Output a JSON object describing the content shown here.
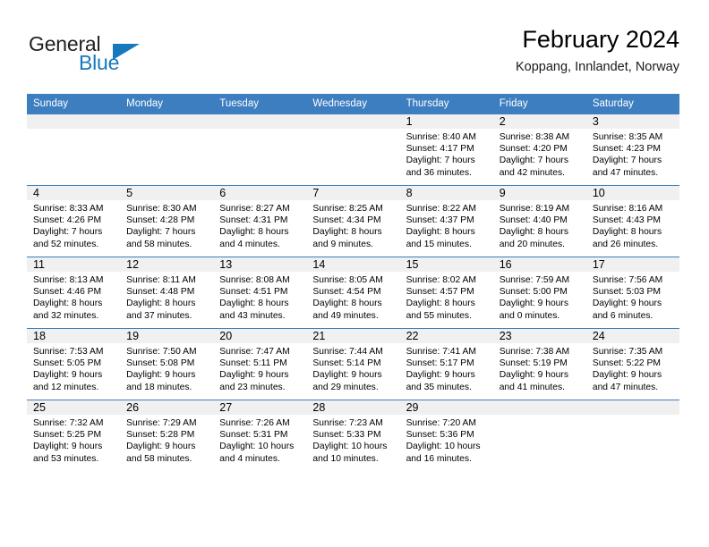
{
  "brand": {
    "name_top": "General",
    "name_bottom": "Blue",
    "triangle_icon": "brand-triangle-icon",
    "color_dark": "#231f20",
    "color_blue": "#1878be"
  },
  "header": {
    "title": "February 2024",
    "subtitle": "Koppang, Innlandet, Norway"
  },
  "theme": {
    "header_blue": "#3c7ebf",
    "daynum_band": "#f0f0f0",
    "text": "#000000"
  },
  "weekdays": [
    "Sunday",
    "Monday",
    "Tuesday",
    "Wednesday",
    "Thursday",
    "Friday",
    "Saturday"
  ],
  "weeks": [
    [
      {
        "day": "",
        "lines": []
      },
      {
        "day": "",
        "lines": []
      },
      {
        "day": "",
        "lines": []
      },
      {
        "day": "",
        "lines": []
      },
      {
        "day": "1",
        "lines": [
          "Sunrise: 8:40 AM",
          "Sunset: 4:17 PM",
          "Daylight: 7 hours",
          "and 36 minutes."
        ]
      },
      {
        "day": "2",
        "lines": [
          "Sunrise: 8:38 AM",
          "Sunset: 4:20 PM",
          "Daylight: 7 hours",
          "and 42 minutes."
        ]
      },
      {
        "day": "3",
        "lines": [
          "Sunrise: 8:35 AM",
          "Sunset: 4:23 PM",
          "Daylight: 7 hours",
          "and 47 minutes."
        ]
      }
    ],
    [
      {
        "day": "4",
        "lines": [
          "Sunrise: 8:33 AM",
          "Sunset: 4:26 PM",
          "Daylight: 7 hours",
          "and 52 minutes."
        ]
      },
      {
        "day": "5",
        "lines": [
          "Sunrise: 8:30 AM",
          "Sunset: 4:28 PM",
          "Daylight: 7 hours",
          "and 58 minutes."
        ]
      },
      {
        "day": "6",
        "lines": [
          "Sunrise: 8:27 AM",
          "Sunset: 4:31 PM",
          "Daylight: 8 hours",
          "and 4 minutes."
        ]
      },
      {
        "day": "7",
        "lines": [
          "Sunrise: 8:25 AM",
          "Sunset: 4:34 PM",
          "Daylight: 8 hours",
          "and 9 minutes."
        ]
      },
      {
        "day": "8",
        "lines": [
          "Sunrise: 8:22 AM",
          "Sunset: 4:37 PM",
          "Daylight: 8 hours",
          "and 15 minutes."
        ]
      },
      {
        "day": "9",
        "lines": [
          "Sunrise: 8:19 AM",
          "Sunset: 4:40 PM",
          "Daylight: 8 hours",
          "and 20 minutes."
        ]
      },
      {
        "day": "10",
        "lines": [
          "Sunrise: 8:16 AM",
          "Sunset: 4:43 PM",
          "Daylight: 8 hours",
          "and 26 minutes."
        ]
      }
    ],
    [
      {
        "day": "11",
        "lines": [
          "Sunrise: 8:13 AM",
          "Sunset: 4:46 PM",
          "Daylight: 8 hours",
          "and 32 minutes."
        ]
      },
      {
        "day": "12",
        "lines": [
          "Sunrise: 8:11 AM",
          "Sunset: 4:48 PM",
          "Daylight: 8 hours",
          "and 37 minutes."
        ]
      },
      {
        "day": "13",
        "lines": [
          "Sunrise: 8:08 AM",
          "Sunset: 4:51 PM",
          "Daylight: 8 hours",
          "and 43 minutes."
        ]
      },
      {
        "day": "14",
        "lines": [
          "Sunrise: 8:05 AM",
          "Sunset: 4:54 PM",
          "Daylight: 8 hours",
          "and 49 minutes."
        ]
      },
      {
        "day": "15",
        "lines": [
          "Sunrise: 8:02 AM",
          "Sunset: 4:57 PM",
          "Daylight: 8 hours",
          "and 55 minutes."
        ]
      },
      {
        "day": "16",
        "lines": [
          "Sunrise: 7:59 AM",
          "Sunset: 5:00 PM",
          "Daylight: 9 hours",
          "and 0 minutes."
        ]
      },
      {
        "day": "17",
        "lines": [
          "Sunrise: 7:56 AM",
          "Sunset: 5:03 PM",
          "Daylight: 9 hours",
          "and 6 minutes."
        ]
      }
    ],
    [
      {
        "day": "18",
        "lines": [
          "Sunrise: 7:53 AM",
          "Sunset: 5:05 PM",
          "Daylight: 9 hours",
          "and 12 minutes."
        ]
      },
      {
        "day": "19",
        "lines": [
          "Sunrise: 7:50 AM",
          "Sunset: 5:08 PM",
          "Daylight: 9 hours",
          "and 18 minutes."
        ]
      },
      {
        "day": "20",
        "lines": [
          "Sunrise: 7:47 AM",
          "Sunset: 5:11 PM",
          "Daylight: 9 hours",
          "and 23 minutes."
        ]
      },
      {
        "day": "21",
        "lines": [
          "Sunrise: 7:44 AM",
          "Sunset: 5:14 PM",
          "Daylight: 9 hours",
          "and 29 minutes."
        ]
      },
      {
        "day": "22",
        "lines": [
          "Sunrise: 7:41 AM",
          "Sunset: 5:17 PM",
          "Daylight: 9 hours",
          "and 35 minutes."
        ]
      },
      {
        "day": "23",
        "lines": [
          "Sunrise: 7:38 AM",
          "Sunset: 5:19 PM",
          "Daylight: 9 hours",
          "and 41 minutes."
        ]
      },
      {
        "day": "24",
        "lines": [
          "Sunrise: 7:35 AM",
          "Sunset: 5:22 PM",
          "Daylight: 9 hours",
          "and 47 minutes."
        ]
      }
    ],
    [
      {
        "day": "25",
        "lines": [
          "Sunrise: 7:32 AM",
          "Sunset: 5:25 PM",
          "Daylight: 9 hours",
          "and 53 minutes."
        ]
      },
      {
        "day": "26",
        "lines": [
          "Sunrise: 7:29 AM",
          "Sunset: 5:28 PM",
          "Daylight: 9 hours",
          "and 58 minutes."
        ]
      },
      {
        "day": "27",
        "lines": [
          "Sunrise: 7:26 AM",
          "Sunset: 5:31 PM",
          "Daylight: 10 hours",
          "and 4 minutes."
        ]
      },
      {
        "day": "28",
        "lines": [
          "Sunrise: 7:23 AM",
          "Sunset: 5:33 PM",
          "Daylight: 10 hours",
          "and 10 minutes."
        ]
      },
      {
        "day": "29",
        "lines": [
          "Sunrise: 7:20 AM",
          "Sunset: 5:36 PM",
          "Daylight: 10 hours",
          "and 16 minutes."
        ]
      },
      {
        "day": "",
        "lines": []
      },
      {
        "day": "",
        "lines": []
      }
    ]
  ]
}
